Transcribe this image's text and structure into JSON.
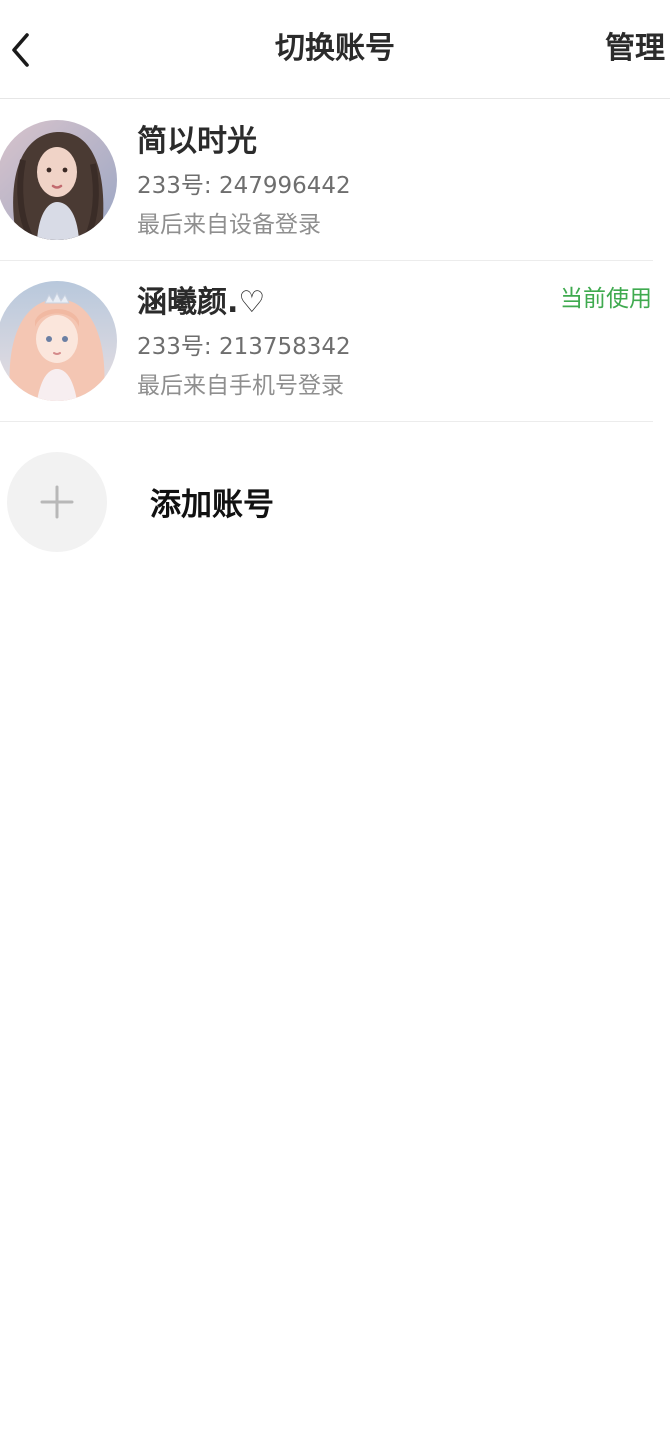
{
  "header": {
    "title": "切换账号",
    "manage_label": "管理",
    "back_icon": "chevron-left-icon"
  },
  "accounts": [
    {
      "name": "简以时光",
      "id_text": "233号: 247996442",
      "login_text": "最后来自设备登录",
      "current": false
    },
    {
      "name": "涵曦颜.♡",
      "id_text": "233号: 213758342",
      "login_text": "最后来自手机号登录",
      "current": true,
      "current_label": "当前使用"
    }
  ],
  "add_account": {
    "label": "添加账号",
    "icon": "plus-icon"
  },
  "colors": {
    "accent_green": "#3faa4f",
    "divider": "#e6e6e6",
    "add_circle_bg": "#f2f2f2"
  }
}
